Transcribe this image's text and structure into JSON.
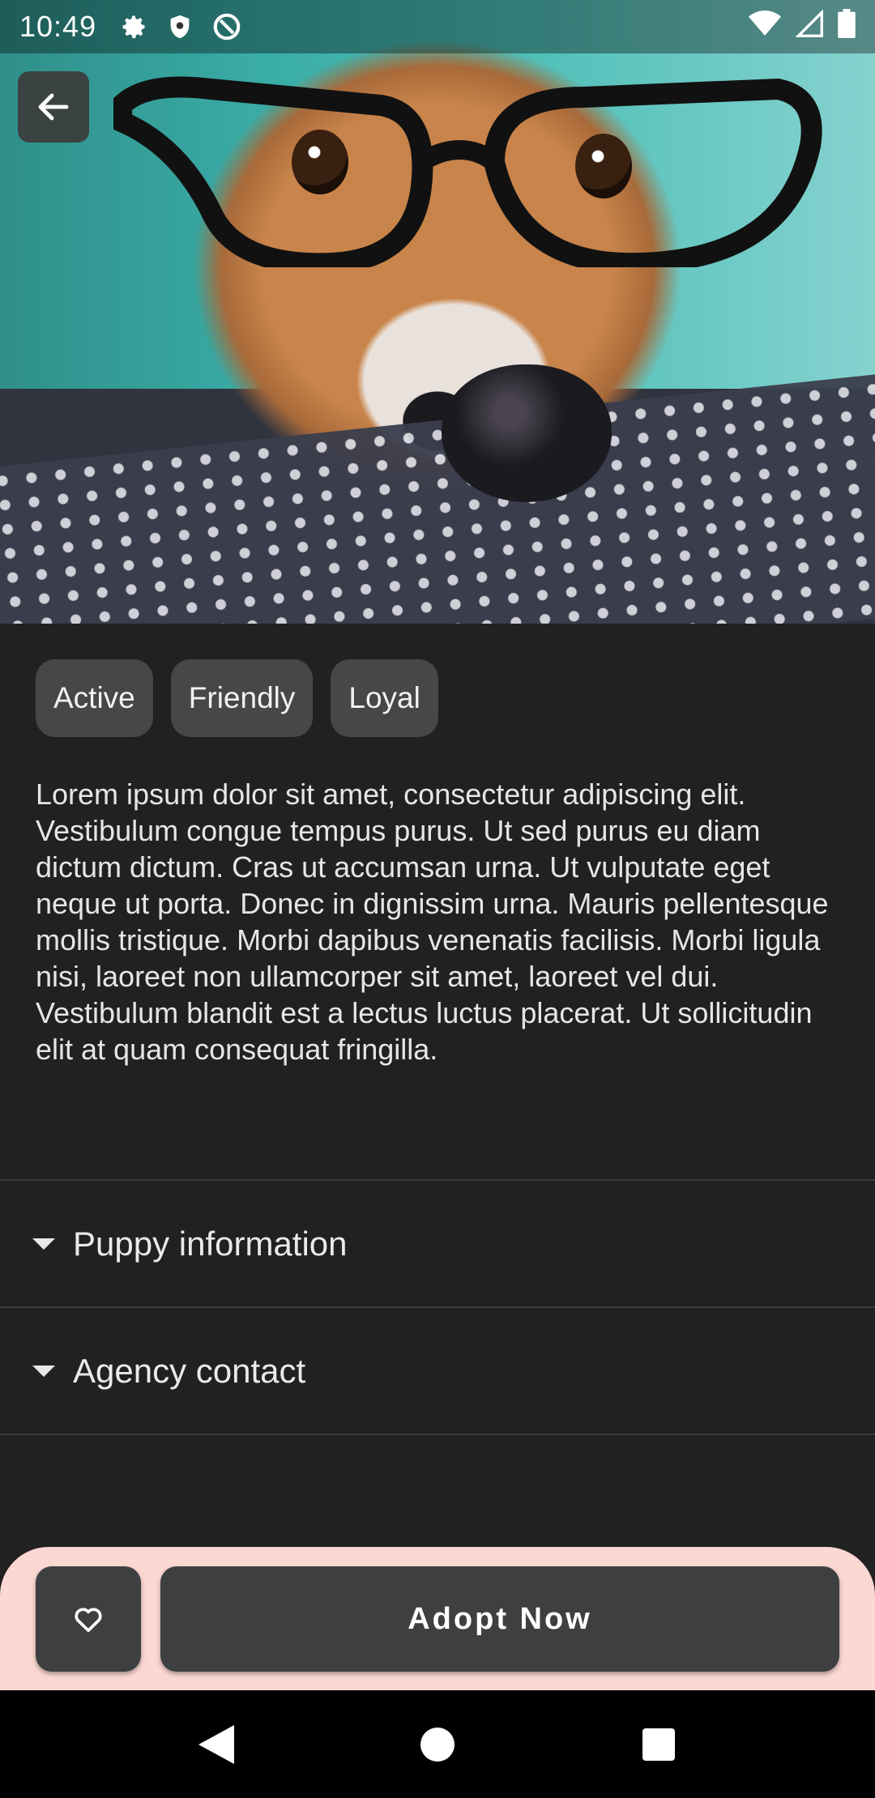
{
  "status_bar": {
    "time": "10:49",
    "icons": [
      "gear-icon",
      "shield-icon",
      "data-saver-icon",
      "wifi-icon",
      "signal-icon",
      "battery-icon"
    ]
  },
  "hero": {
    "image_description_icon": "corgi-with-glasses-photo"
  },
  "toolbar": {
    "back_icon": "arrow-left-icon"
  },
  "tags": [
    "Active",
    "Friendly",
    "Loyal"
  ],
  "description": "Lorem ipsum dolor sit amet, consectetur adipiscing elit. Vestibulum congue tempus purus. Ut sed purus eu diam dictum dictum. Cras ut accumsan urna. Ut vulputate eget neque ut porta. Donec in dignissim urna. Mauris pellentesque mollis tristique. Morbi dapibus venenatis facilisis. Morbi ligula nisi, laoreet non ullamcorper sit amet, laoreet vel dui. Vestibulum blandit est a lectus luctus placerat. Ut sollicitudin elit at quam consequat fringilla.",
  "sections": [
    {
      "label": "Puppy information",
      "expanded": false
    },
    {
      "label": "Agency contact",
      "expanded": false
    }
  ],
  "actions": {
    "favorite_icon": "heart-outline-icon",
    "adopt_label": "Adopt Now"
  },
  "colors": {
    "background": "#212121",
    "chip": "#474747",
    "panel": "#fbd8d2",
    "button": "#3d3f41"
  },
  "nav_bar": [
    "back-triangle-icon",
    "home-circle-icon",
    "recents-square-icon"
  ]
}
